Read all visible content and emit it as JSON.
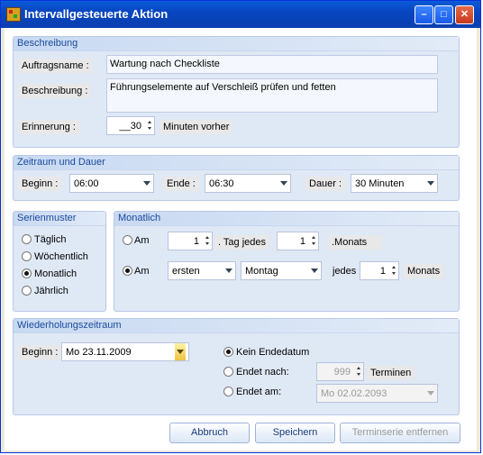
{
  "window": {
    "title": "Intervallgesteuerte Aktion"
  },
  "beschreibung": {
    "title": "Beschreibung",
    "auftragsname_label": "Auftragsname :",
    "auftragsname_value": "Wartung nach Checkliste",
    "beschreibung_label": "Beschreibung :",
    "beschreibung_value": "Führungselemente auf Verschleiß prüfen und fetten",
    "erinnerung_label": "Erinnerung :",
    "erinnerung_value": "__30",
    "erinnerung_unit": "Minuten vorher"
  },
  "zeitraum": {
    "title": "Zeitraum und Dauer",
    "beginn_label": "Beginn :",
    "beginn_value": "06:00",
    "ende_label": "Ende :",
    "ende_value": "06:30",
    "dauer_label": "Dauer :",
    "dauer_value": "30 Minuten"
  },
  "serienmuster": {
    "title": "Serienmuster",
    "options": [
      "Täglich",
      "Wöchentlich",
      "Monatlich",
      "Jährlich"
    ],
    "selected": "Monatlich"
  },
  "monatlich": {
    "title": "Monatlich",
    "row1": {
      "am": "Am",
      "day": "1",
      "tag_jedes": ". Tag jedes",
      "months": "1",
      "monats": ".Monats"
    },
    "row2": {
      "am": "Am",
      "ordinal": "ersten",
      "weekday": "Montag",
      "jedes": "jedes",
      "months": "1",
      "monats": "Monats"
    },
    "selected": "row2"
  },
  "wiederholung": {
    "title": "Wiederholungszeitraum",
    "beginn_label": "Beginn :",
    "beginn_value": "Mo 23.11.2009",
    "kein_ende": "Kein Endedatum",
    "endet_nach": "Endet nach:",
    "endet_nach_value": "999",
    "termine": "Terminen",
    "endet_am": "Endet am:",
    "endet_am_value": "Mo 02.02.2093",
    "selected": "kein_ende"
  },
  "buttons": {
    "abbruch": "Abbruch",
    "speichern": "Speichern",
    "entfernen": "Terminserie entfernen"
  }
}
